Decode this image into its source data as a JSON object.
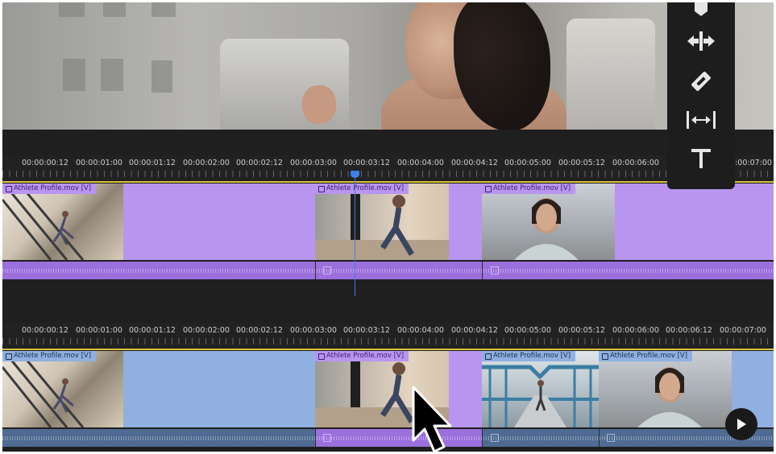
{
  "timecodes": [
    "00:00:00:12",
    "00:00:01:00",
    "00:00:01:12",
    "00:00:02:00",
    "00:00:02:12",
    "00:00:03:00",
    "00:00:03:12",
    "00:00:04:00",
    "00:00:04:12",
    "00:00:05:00",
    "00:00:05:12",
    "00:00:06:00",
    "00:00:06:12",
    "00:00:07:00"
  ],
  "top_timeline": {
    "visible_timecodes": [
      "00:00:00:12",
      "00:00:01:00",
      "00:00:01:12",
      "00:00:02:00",
      "00:00:02:12",
      "00:00:03:00",
      "00:00:03:12",
      "00:00:04:00",
      "00:00:04:12",
      "00:00:05:00",
      "00:00:05:12",
      "00:00:06:00",
      "00:00:07:00"
    ],
    "clips": [
      {
        "label": "Athlete Profile.mov [V]"
      },
      {
        "label": "Athlete Profile.mov [V]"
      },
      {
        "label": "Athlete Profile.mov [V]"
      }
    ]
  },
  "bottom_timeline": {
    "clips": [
      {
        "label": "Athlete Profile.mov [V]"
      },
      {
        "label": "Athlete Profile.mov [V]"
      },
      {
        "label": "Athlete Profile.mov [V]"
      },
      {
        "label": "Athlete Profile.mov [V]"
      }
    ]
  },
  "tools": [
    "marker-icon",
    "ripple-edit-icon",
    "razor-icon",
    "slip-icon",
    "type-icon"
  ],
  "colors": {
    "clip_purple": "#b895ef",
    "clip_blue": "#8fb0e0",
    "audio_purple": "#9b6fdc",
    "audio_blue": "#4f6b93",
    "playhead": "#3c7fe8",
    "track_line": "#d9c23a"
  }
}
